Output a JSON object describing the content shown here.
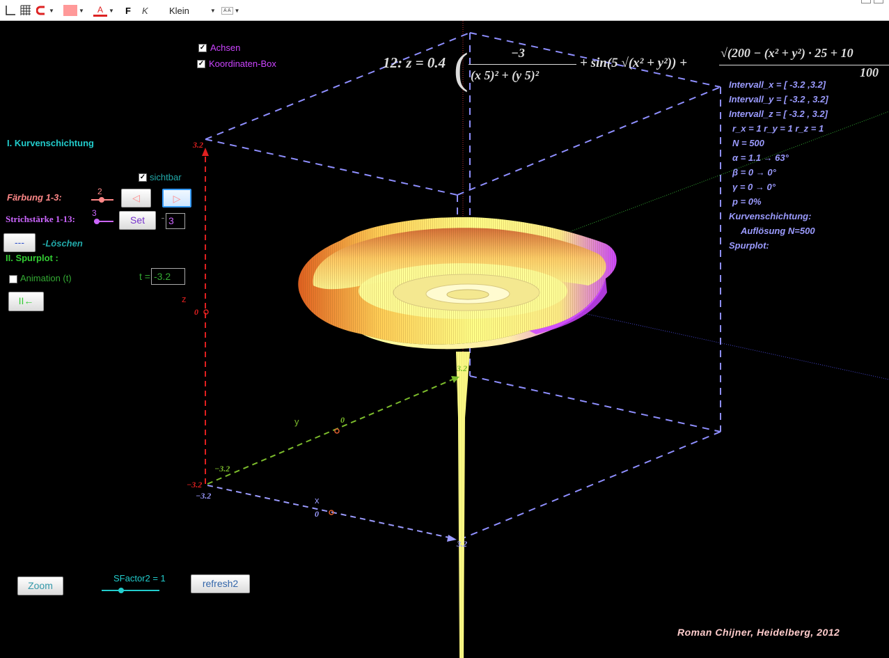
{
  "toolbar": {
    "bold_label": "F",
    "italic_label": "K",
    "size_label": "Klein",
    "size_small_label": "A A"
  },
  "controls": {
    "achsen_label": "Achsen",
    "koordinaten_box_label": "Koordinaten-Box",
    "section1_title": "I. Kurvenschichtung",
    "sichtbar_label": "sichtbar",
    "faerbung_label": "Färbung 1-3:",
    "faerbung_value": "2",
    "prev_button": "◁",
    "next_button": "▷",
    "strichstaerke_label": "Strichstärke 1-13:",
    "strichstaerke_value": "3",
    "set_button": "Set",
    "set_input_value": "3",
    "loeschen_button": "---",
    "loeschen_label": "-Löschen",
    "section2_title": "II. Spurplot :",
    "animation_label": "Animation (t)",
    "t_label": "t =",
    "t_value": "-3.2",
    "reset_button": "II←",
    "zoom_button": "Zoom",
    "sfactor_label": "SFactor2 = 1",
    "refresh_button": "refresh2"
  },
  "formula": {
    "prefix": "12: z = 0.4",
    "numerator1": "−3",
    "denominator1": "(x 5)² + (y 5)²",
    "middle": "+ sin(5 √(x² + y²)) +",
    "numerator2": "√(200 − (x² + y²) · 25 + 10",
    "denominator2": "100"
  },
  "info": {
    "intervall_x": "Intervall_x = [ -3.2 ,3.2]",
    "intervall_y": "Intervall_y = [ -3.2 , 3.2]",
    "intervall_z": "Intervall_z = [ -3.2 , 3.2]",
    "r_values": "r_x = 1  r_y = 1  r_z = 1",
    "n": "N = 500",
    "alpha": "α = 1.1 → 63°",
    "beta": "β = 0 → 0°",
    "gamma": "γ = 0 → 0°",
    "p": "p = 0%",
    "kurven": "Kurvenschichtung:",
    "aufloesung": "Auflösung N=500",
    "spurplot": "Spurplot:"
  },
  "axes": {
    "z_top": "3.2",
    "z_zero": "0",
    "z_label": "z",
    "z_bottom": "−3.2",
    "y_label": "y",
    "y_zero": "0",
    "y_neg": "−3.2",
    "y_pos": "3.2",
    "x_label": "x",
    "x_zero": "0",
    "x_neg": "−3.2",
    "x_pos": "3.2"
  },
  "credit": "Roman Chijner, Heidelberg, 2012",
  "colors": {
    "axes_label": "#cc44ff",
    "section1": "#22cccc",
    "faerbung": "#ff8888",
    "strich": "#cc66ff",
    "section2": "#33cc33",
    "info": "#9b9bff",
    "box": "#8f8fff",
    "surface_yellow": "#ffff88",
    "surface_orange": "#e06020",
    "surface_violet": "#cc44ff",
    "credit": "#ffcccc"
  }
}
